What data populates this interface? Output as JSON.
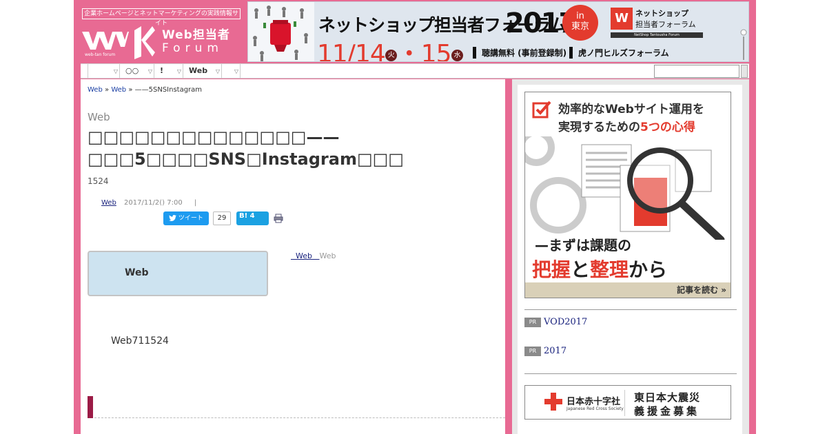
{
  "header": {
    "tagline": "企業ホームページとネットマーケティングの実践情報サイト",
    "logo_title": "Web担当者",
    "logo_forum": "Forum",
    "logo_sub": "web-tan forum"
  },
  "banner": {
    "title": "ネットショップ担当者フォーラム",
    "year": "2017",
    "in_label": "in",
    "city": "東京",
    "logo_line1": "ネットショップ",
    "logo_line2": "担当者フォーラム",
    "logo_bar": "NetShop Tantousha Forum",
    "date1": "11/14",
    "dow1": "火",
    "date2": "15",
    "dow2": "水",
    "free_text": "聴講無料 (事前登録制)",
    "venue": "虎ノ門ヒルズフォーラム"
  },
  "nav": {
    "items": [
      {
        "label": ""
      },
      {
        "label": "○○"
      },
      {
        "label": "!"
      },
      {
        "label": "Web"
      },
      {
        "label": ""
      }
    ],
    "search_placeholder": ""
  },
  "breadcrumb": {
    "items": [
      "Web",
      "Web",
      "——5SNSInstagram"
    ],
    "separator": "»"
  },
  "article": {
    "kicker": "Web",
    "title": "□□□□□□□□□□□□□□——□□□5□□□□SNS□Instagram□□□",
    "count": "1524",
    "meta_link": "Web",
    "date": "2017/11/2() 7:00",
    "meta_sep": "|",
    "tweet_label": "ツイート",
    "tweet_count": "29",
    "hatena_label": "B!",
    "hatena_count": "4",
    "section_box_label": "Web",
    "related_link": "Web",
    "related_text": "Web",
    "lead": "Web711524"
  },
  "sidebar": {
    "ad_line1": "効率的なWebサイト運用を",
    "ad_line2_a": "実現するための",
    "ad_line2_b": "5つの心得",
    "ad_foot1": "—まずは課題の",
    "ad_foot2_a": "把握",
    "ad_foot2_b": "と",
    "ad_foot2_c": "整理",
    "ad_foot2_d": "から",
    "ad_read": "記事を読む »",
    "pr": [
      {
        "tag": "PR",
        "label": "VOD2017"
      },
      {
        "tag": "PR",
        "label": "2017"
      }
    ],
    "redcross_name": "日本赤十字社",
    "redcross_name_en": "Japanese Red Cross Society",
    "redcross_msg1": "東日本大震災",
    "redcross_msg2": "義援金募集"
  },
  "colors": {
    "brand_pink": "#e86a93",
    "accent_red": "#e33b2e",
    "heading_bar": "#9b1b46",
    "link_blue": "#1a237e",
    "section_box": "#cde3f0"
  }
}
